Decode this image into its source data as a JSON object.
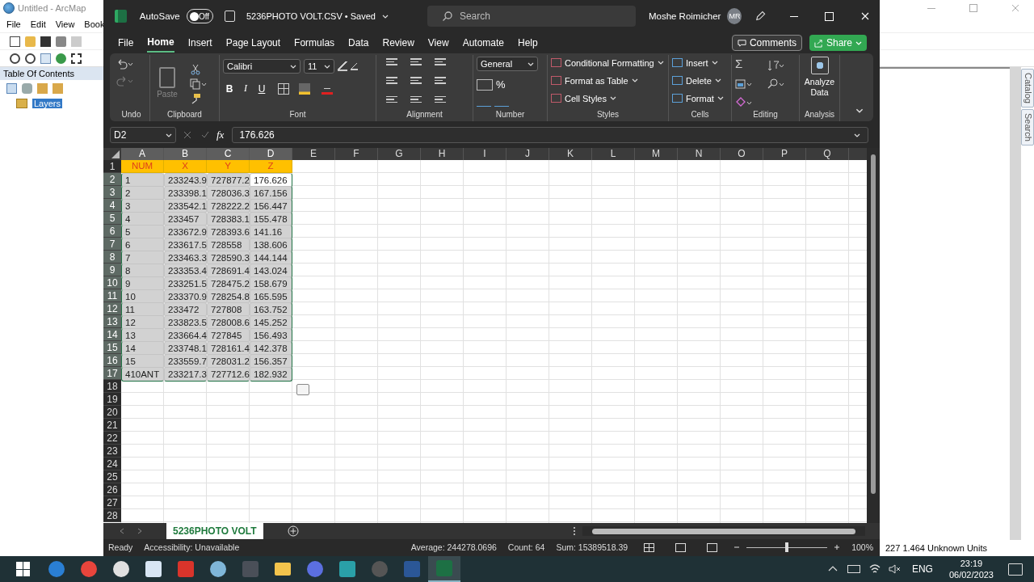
{
  "arcmap": {
    "title": "Untitled - ArcMap",
    "menu": [
      "File",
      "Edit",
      "View",
      "Book"
    ],
    "toc_title": "Table Of Contents",
    "layers": {
      "label": "Layers",
      "selected": true
    },
    "side_tabs": [
      "Catalog",
      "Search"
    ],
    "status": "227 1.464 Unknown Units"
  },
  "excel": {
    "autosave": {
      "label": "AutoSave",
      "on": false,
      "state": "Off"
    },
    "filename": "5236PHOTO VOLT.CSV • Saved",
    "search": {
      "placeholder": "Search"
    },
    "user": {
      "name": "Moshe Roimicher",
      "initials": "MR"
    },
    "tabs": [
      {
        "label": "File",
        "selected": false
      },
      {
        "label": "Home",
        "selected": true
      },
      {
        "label": "Insert",
        "selected": false
      },
      {
        "label": "Page Layout",
        "selected": false
      },
      {
        "label": "Formulas",
        "selected": false
      },
      {
        "label": "Data",
        "selected": false
      },
      {
        "label": "Review",
        "selected": false
      },
      {
        "label": "View",
        "selected": false
      },
      {
        "label": "Automate",
        "selected": false
      },
      {
        "label": "Help",
        "selected": false
      }
    ],
    "comments": "Comments",
    "share": "Share",
    "ribbon": {
      "undo": "Undo",
      "clipboard": {
        "label": "Clipboard",
        "paste": "Paste"
      },
      "font": {
        "label": "Font",
        "family": "Calibri",
        "size": "11",
        "bold": "B",
        "italic": "I",
        "underline": "U"
      },
      "alignment": "Alignment",
      "number": {
        "label": "Number",
        "format": "General",
        "percent": "%"
      },
      "styles": {
        "label": "Styles",
        "items": [
          "Conditional Formatting",
          "Format as Table",
          "Cell Styles"
        ]
      },
      "cells": {
        "label": "Cells",
        "items": [
          "Insert",
          "Delete",
          "Format"
        ]
      },
      "editing": {
        "label": "Editing",
        "autosum": "Σ"
      },
      "analysis": {
        "label": "Analysis",
        "button": "Analyze Data"
      }
    },
    "formula_bar": {
      "name_box": "D2",
      "fx": "fx",
      "value": "176.626"
    },
    "sheet": {
      "columns": [
        {
          "label": "A",
          "selected": true
        },
        {
          "label": "B",
          "selected": true
        },
        {
          "label": "C",
          "selected": true
        },
        {
          "label": "D",
          "selected": true
        },
        {
          "label": "E",
          "selected": false
        },
        {
          "label": "F",
          "selected": false
        },
        {
          "label": "G",
          "selected": false
        },
        {
          "label": "H",
          "selected": false
        },
        {
          "label": "I",
          "selected": false
        },
        {
          "label": "J",
          "selected": false
        },
        {
          "label": "K",
          "selected": false
        },
        {
          "label": "L",
          "selected": false
        },
        {
          "label": "M",
          "selected": false
        },
        {
          "label": "N",
          "selected": false
        },
        {
          "label": "O",
          "selected": false
        },
        {
          "label": "P",
          "selected": false
        },
        {
          "label": "Q",
          "selected": false
        }
      ],
      "header_row": {
        "number": "1",
        "cells": [
          "NUM",
          "X",
          "Y",
          "Z"
        ]
      },
      "rows": [
        {
          "number": "2",
          "selected": true,
          "cells": [
            {
              "text": "1",
              "selected": true,
              "active": false
            },
            {
              "text": "233243.9",
              "selected": true,
              "active": false
            },
            {
              "text": "727877.2",
              "selected": true,
              "active": false
            },
            {
              "text": "176.626",
              "selected": true,
              "active": true
            }
          ]
        },
        {
          "number": "3",
          "selected": true,
          "cells": [
            {
              "text": "2",
              "selected": true,
              "active": false
            },
            {
              "text": "233398.1",
              "selected": true,
              "active": false
            },
            {
              "text": "728036.3",
              "selected": true,
              "active": false
            },
            {
              "text": "167.156",
              "selected": true,
              "active": false
            }
          ]
        },
        {
          "number": "4",
          "selected": true,
          "cells": [
            {
              "text": "3",
              "selected": true,
              "active": false
            },
            {
              "text": "233542.1",
              "selected": true,
              "active": false
            },
            {
              "text": "728222.2",
              "selected": true,
              "active": false
            },
            {
              "text": "156.447",
              "selected": true,
              "active": false
            }
          ]
        },
        {
          "number": "5",
          "selected": true,
          "cells": [
            {
              "text": "4",
              "selected": true,
              "active": false
            },
            {
              "text": "233457",
              "selected": true,
              "active": false
            },
            {
              "text": "728383.1",
              "selected": true,
              "active": false
            },
            {
              "text": "155.478",
              "selected": true,
              "active": false
            }
          ]
        },
        {
          "number": "6",
          "selected": true,
          "cells": [
            {
              "text": "5",
              "selected": true,
              "active": false
            },
            {
              "text": "233672.9",
              "selected": true,
              "active": false
            },
            {
              "text": "728393.6",
              "selected": true,
              "active": false
            },
            {
              "text": "141.16",
              "selected": true,
              "active": false
            }
          ]
        },
        {
          "number": "7",
          "selected": true,
          "cells": [
            {
              "text": "6",
              "selected": true,
              "active": false
            },
            {
              "text": "233617.5",
              "selected": true,
              "active": false
            },
            {
              "text": "728558",
              "selected": true,
              "active": false
            },
            {
              "text": "138.606",
              "selected": true,
              "active": false
            }
          ]
        },
        {
          "number": "8",
          "selected": true,
          "cells": [
            {
              "text": "7",
              "selected": true,
              "active": false
            },
            {
              "text": "233463.3",
              "selected": true,
              "active": false
            },
            {
              "text": "728590.3",
              "selected": true,
              "active": false
            },
            {
              "text": "144.144",
              "selected": true,
              "active": false
            }
          ]
        },
        {
          "number": "9",
          "selected": true,
          "cells": [
            {
              "text": "8",
              "selected": true,
              "active": false
            },
            {
              "text": "233353.4",
              "selected": true,
              "active": false
            },
            {
              "text": "728691.4",
              "selected": true,
              "active": false
            },
            {
              "text": "143.024",
              "selected": true,
              "active": false
            }
          ]
        },
        {
          "number": "10",
          "selected": true,
          "cells": [
            {
              "text": "9",
              "selected": true,
              "active": false
            },
            {
              "text": "233251.5",
              "selected": true,
              "active": false
            },
            {
              "text": "728475.2",
              "selected": true,
              "active": false
            },
            {
              "text": "158.679",
              "selected": true,
              "active": false
            }
          ]
        },
        {
          "number": "11",
          "selected": true,
          "cells": [
            {
              "text": "10",
              "selected": true,
              "active": false
            },
            {
              "text": "233370.9",
              "selected": true,
              "active": false
            },
            {
              "text": "728254.8",
              "selected": true,
              "active": false
            },
            {
              "text": "165.595",
              "selected": true,
              "active": false
            }
          ]
        },
        {
          "number": "12",
          "selected": true,
          "cells": [
            {
              "text": "11",
              "selected": true,
              "active": false
            },
            {
              "text": "233472",
              "selected": true,
              "active": false
            },
            {
              "text": "727808",
              "selected": true,
              "active": false
            },
            {
              "text": "163.752",
              "selected": true,
              "active": false
            }
          ]
        },
        {
          "number": "13",
          "selected": true,
          "cells": [
            {
              "text": "12",
              "selected": true,
              "active": false
            },
            {
              "text": "233823.5",
              "selected": true,
              "active": false
            },
            {
              "text": "728008.6",
              "selected": true,
              "active": false
            },
            {
              "text": "145.252",
              "selected": true,
              "active": false
            }
          ]
        },
        {
          "number": "14",
          "selected": true,
          "cells": [
            {
              "text": "13",
              "selected": true,
              "active": false
            },
            {
              "text": "233664.4",
              "selected": true,
              "active": false
            },
            {
              "text": "727845",
              "selected": true,
              "active": false
            },
            {
              "text": "156.493",
              "selected": true,
              "active": false
            }
          ]
        },
        {
          "number": "15",
          "selected": true,
          "cells": [
            {
              "text": "14",
              "selected": true,
              "active": false
            },
            {
              "text": "233748.1",
              "selected": true,
              "active": false
            },
            {
              "text": "728161.4",
              "selected": true,
              "active": false
            },
            {
              "text": "142.378",
              "selected": true,
              "active": false
            }
          ]
        },
        {
          "number": "16",
          "selected": true,
          "cells": [
            {
              "text": "15",
              "selected": true,
              "active": false
            },
            {
              "text": "233559.7",
              "selected": true,
              "active": false
            },
            {
              "text": "728031.2",
              "selected": true,
              "active": false
            },
            {
              "text": "156.357",
              "selected": true,
              "active": false
            }
          ]
        },
        {
          "number": "17",
          "selected": true,
          "cells": [
            {
              "text": "410ANT",
              "selected": true,
              "active": false
            },
            {
              "text": "233217.3",
              "selected": true,
              "active": false
            },
            {
              "text": "727712.6",
              "selected": true,
              "active": false
            },
            {
              "text": "182.932",
              "selected": true,
              "active": false
            }
          ]
        }
      ],
      "empty_rows": [
        "18",
        "19",
        "20",
        "21",
        "22",
        "23",
        "24",
        "25",
        "26",
        "27",
        "28"
      ]
    },
    "sheet_tabs": [
      {
        "label": "5236PHOTO VOLT",
        "selected": true
      }
    ],
    "status": {
      "ready": "Ready",
      "accessibility": "Accessibility: Unavailable",
      "average": "Average: 244278.0696",
      "count": "Count: 64",
      "sum": "Sum: 15389518.39",
      "zoom": "100%",
      "zoom_slider": {
        "level": 0.5
      }
    }
  },
  "taskbar": {
    "apps": [
      {
        "kind": "globe",
        "selected": false
      },
      {
        "kind": "browser",
        "selected": false
      },
      {
        "kind": "chat",
        "selected": false
      },
      {
        "kind": "letter-app",
        "selected": false
      },
      {
        "kind": "red-app",
        "selected": false
      },
      {
        "kind": "scissors",
        "selected": false
      },
      {
        "kind": "editor",
        "selected": false
      },
      {
        "kind": "folder",
        "selected": false
      },
      {
        "kind": "assistant",
        "selected": false
      },
      {
        "kind": "terminal",
        "selected": false
      },
      {
        "kind": "recorder",
        "selected": false
      },
      {
        "kind": "document",
        "selected": false
      },
      {
        "kind": "spreadsheet",
        "selected": true
      }
    ],
    "language": "ENG",
    "time": "23:19",
    "date": "06/02/2023"
  }
}
